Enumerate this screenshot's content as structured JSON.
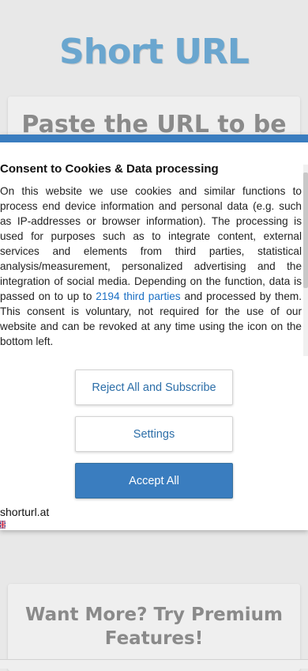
{
  "page": {
    "title": "Short URL",
    "card_top_heading": "Paste the URL to be",
    "card_bottom_heading": "Want More? Try Premium Features!"
  },
  "consent": {
    "title": "Consent to Cookies & Data processing",
    "text_before_link": "On this website we use cookies and similar functions to process end device information and personal data (e.g. such as IP-addresses or browser information). The processing is used for purposes such as to integrate content, external services and elements from third parties, statistical analysis/measurement, personalized advertising and the integration of social media. Depending on the function, data is passed on to up to ",
    "link_text": "2194 third parties",
    "text_after_link": " and processed by them. This consent is voluntary, not required for the use of our website and can be revoked at any time using the icon on the bottom left.",
    "buttons": {
      "reject": "Reject All and Subscribe",
      "settings": "Settings",
      "accept": "Accept All"
    },
    "site": "shorturl.at",
    "language_icon": "uk-flag-icon"
  },
  "colors": {
    "accent": "#3a7dbf",
    "title": "#6aa6cf",
    "link": "#1a6fc4"
  }
}
